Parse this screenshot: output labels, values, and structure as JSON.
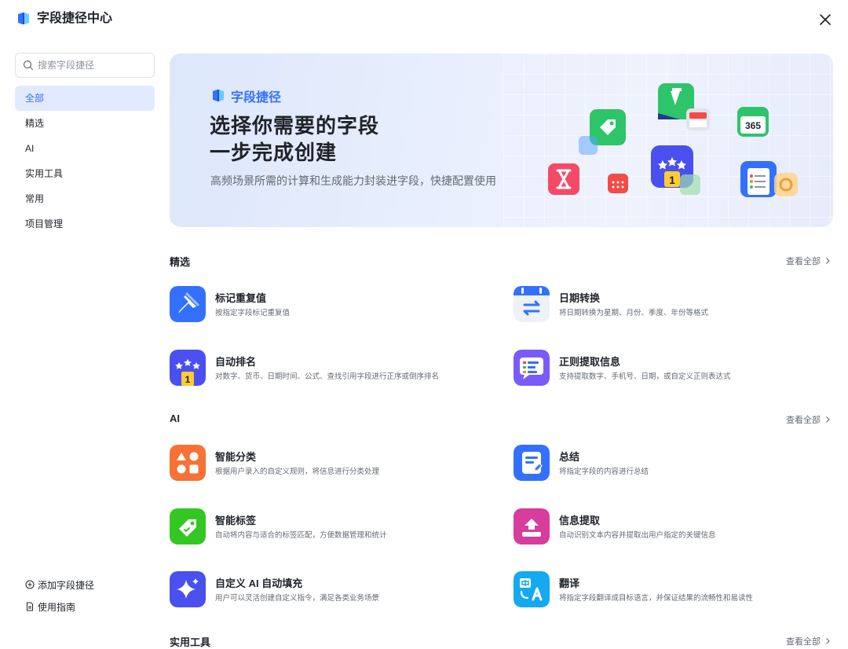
{
  "header": {
    "title": "字段捷径中心",
    "logo_icon": "field-shortcut-logo",
    "close_icon": "close-icon"
  },
  "sidebar": {
    "search_placeholder": "搜索字段捷径",
    "items": [
      {
        "label": "全部",
        "active": true
      },
      {
        "label": "精选",
        "active": false
      },
      {
        "label": "AI",
        "active": false
      },
      {
        "label": "实用工具",
        "active": false
      },
      {
        "label": "常用",
        "active": false
      },
      {
        "label": "项目管理",
        "active": false
      }
    ],
    "footer": [
      {
        "label": "添加字段捷径",
        "icon": "plus-circle-icon"
      },
      {
        "label": "使用指南",
        "icon": "document-icon"
      }
    ]
  },
  "banner": {
    "brand": "字段捷径",
    "line1": "选择你需要的字段",
    "line2": "一步完成创建",
    "subtitle": "高频场景所需的计算和生成能力封装进字段，快捷配置使用"
  },
  "sections": [
    {
      "title": "精选",
      "view_all": "查看全部",
      "cards": [
        {
          "title": "标记重复值",
          "desc": "按指定字段标记重复值",
          "icon": "pin-icon",
          "color": "#3370ff"
        },
        {
          "title": "日期转换",
          "desc": "将日期转换为星期、月份、季度、年份等格式",
          "icon": "calendar-swap-icon",
          "color": "#3370ff"
        },
        {
          "title": "自动排名",
          "desc": "对数字、货币、日期时间、公式、查找引用字段进行正序或倒序排名",
          "icon": "rank-icon",
          "color": "#5b4cf5"
        },
        {
          "title": "正则提取信息",
          "desc": "支持提取数字、手机号、日期，或自定义正则表达式",
          "icon": "regex-icon",
          "color": "#7a5af8"
        }
      ]
    },
    {
      "title": "AI",
      "view_all": "查看全部",
      "cards": [
        {
          "title": "智能分类",
          "desc": "根据用户录入的自定义规则，将信息进行分类处理",
          "icon": "classify-icon",
          "color": "#f77234"
        },
        {
          "title": "总结",
          "desc": "将指定字段的内容进行总结",
          "icon": "summary-icon",
          "color": "#3370ff"
        },
        {
          "title": "智能标签",
          "desc": "自动将内容与适合的标签匹配，方便数据管理和统计",
          "icon": "tag-icon",
          "color": "#34c724"
        },
        {
          "title": "信息提取",
          "desc": "自动识别文本内容并提取出用户指定的关键信息",
          "icon": "extract-icon",
          "color": "#d83c9c"
        },
        {
          "title": "自定义 AI 自动填充",
          "desc": "用户可以灵活创建自定义指令，满足各类业务场景",
          "icon": "sparkle-icon",
          "color": "#4a4ff0"
        },
        {
          "title": "翻译",
          "desc": "将指定字段翻译成目标语言，并保证结果的流畅性和易读性",
          "icon": "translate-icon",
          "color": "#14a9f0"
        }
      ]
    },
    {
      "title": "实用工具",
      "view_all": "查看全部",
      "cards": []
    }
  ]
}
